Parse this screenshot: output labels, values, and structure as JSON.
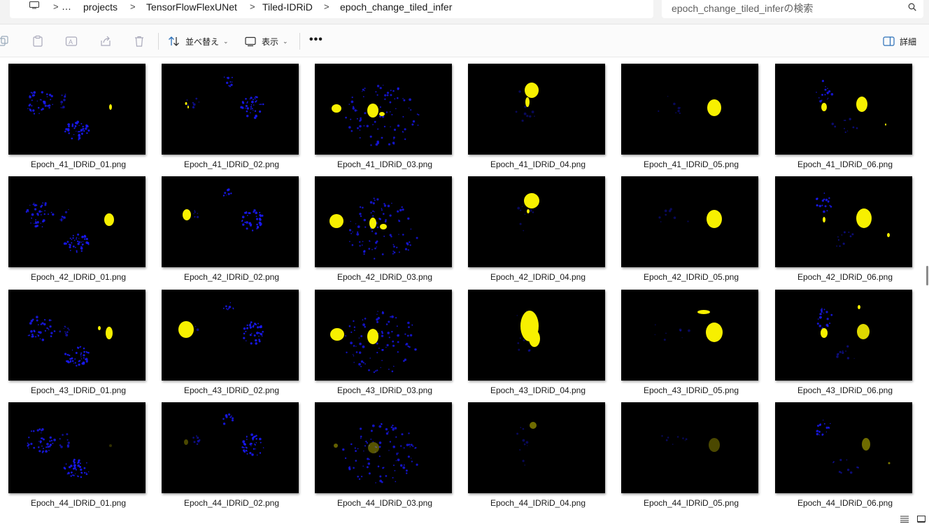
{
  "breadcrumb": {
    "more": "…",
    "items": [
      "projects",
      "TensorFlowFlexUNet",
      "Tiled-IDRiD",
      "epoch_change_tiled_infer"
    ]
  },
  "search": {
    "placeholder": "epoch_change_tiled_inferの検索"
  },
  "toolbar": {
    "sort_label": "並べ替え",
    "view_label": "表示",
    "more_label": "•••",
    "details_label": "詳細"
  },
  "icons": {
    "pc": "computer-icon",
    "search": "search-icon",
    "copy": "copy-icon",
    "paste": "paste-icon",
    "rename": "rename-icon",
    "share": "share-icon",
    "delete": "delete-icon",
    "sort": "sort-icon",
    "view": "view-icon",
    "details": "details-pane-icon"
  },
  "colors": {
    "lesion": "#f7f000",
    "vessel": "#1a1aff",
    "thumb_bg": "#000000"
  },
  "files": [
    [
      "Epoch_41_IDRiD_01.png",
      "Epoch_41_IDRiD_02.png",
      "Epoch_41_IDRiD_03.png",
      "Epoch_41_IDRiD_04.png",
      "Epoch_41_IDRiD_05.png",
      "Epoch_41_IDRiD_06.png"
    ],
    [
      "Epoch_42_IDRiD_01.png",
      "Epoch_42_IDRiD_02.png",
      "Epoch_42_IDRiD_03.png",
      "Epoch_42_IDRiD_04.png",
      "Epoch_42_IDRiD_05.png",
      "Epoch_42_IDRiD_06.png"
    ],
    [
      "Epoch_43_IDRiD_01.png",
      "Epoch_43_IDRiD_02.png",
      "Epoch_43_IDRiD_03.png",
      "Epoch_43_IDRiD_04.png",
      "Epoch_43_IDRiD_05.png",
      "Epoch_43_IDRiD_06.png"
    ],
    [
      "Epoch_44_IDRiD_01.png",
      "Epoch_44_IDRiD_02.png",
      "Epoch_44_IDRiD_03.png",
      "Epoch_44_IDRiD_04.png",
      "Epoch_44_IDRiD_05.png",
      "Epoch_44_IDRiD_06.png"
    ]
  ]
}
